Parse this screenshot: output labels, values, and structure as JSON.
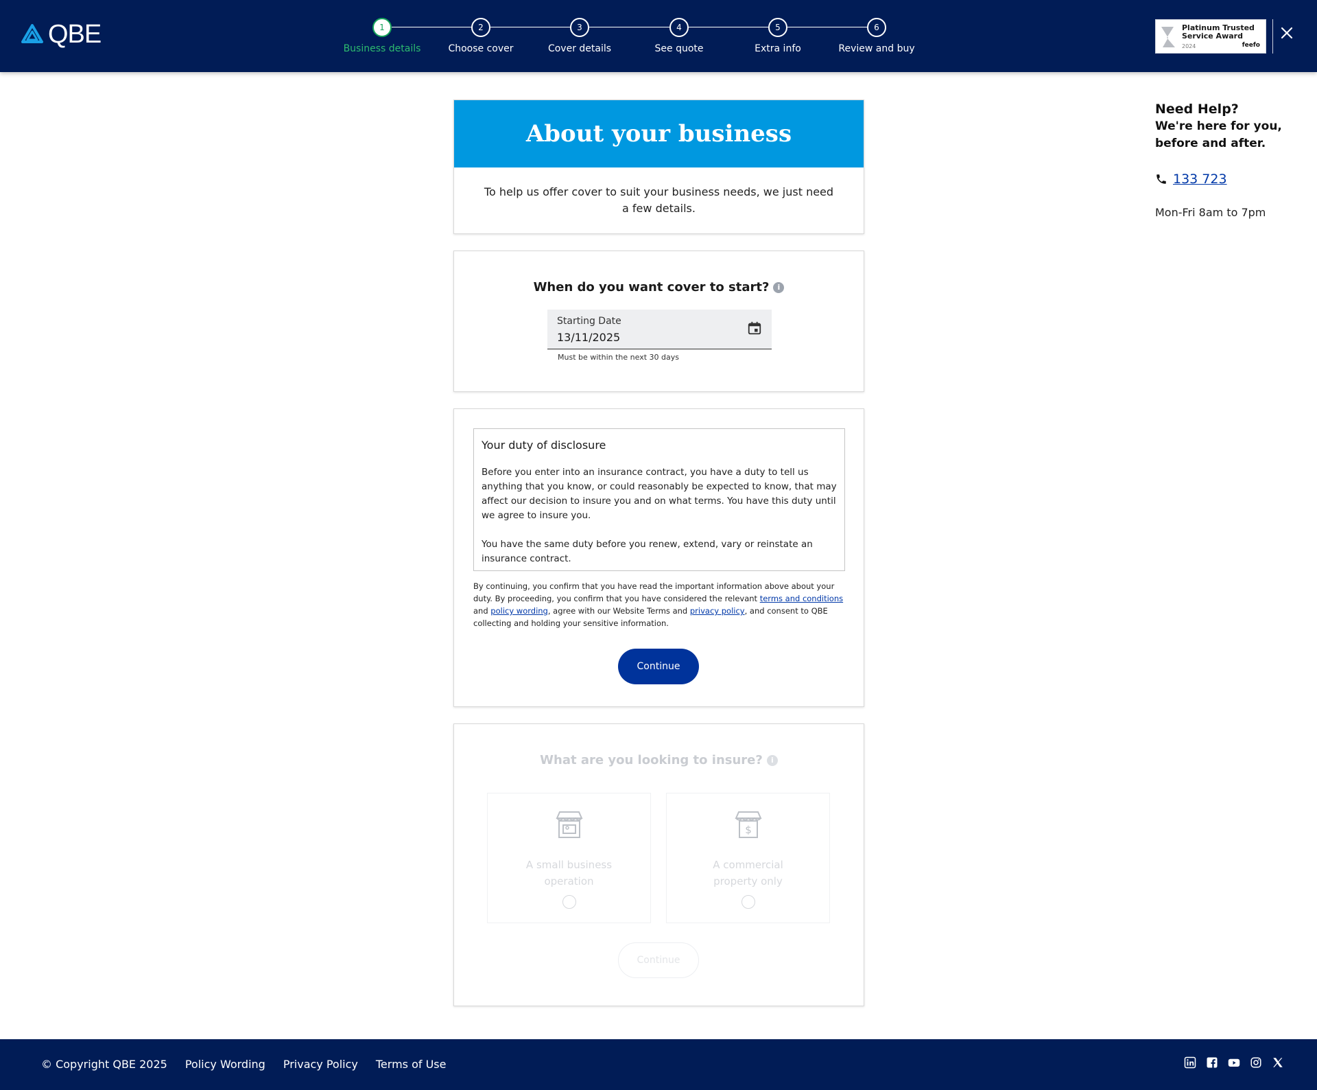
{
  "header": {
    "logo_text": "QBE",
    "steps": [
      {
        "num": "1",
        "label": "Business details",
        "active": true
      },
      {
        "num": "2",
        "label": "Choose cover"
      },
      {
        "num": "3",
        "label": "Cover details"
      },
      {
        "num": "4",
        "label": "See quote"
      },
      {
        "num": "5",
        "label": "Extra info"
      },
      {
        "num": "6",
        "label": "Review and buy"
      }
    ],
    "award": {
      "title": "Platinum Trusted Service Award",
      "year": "2024",
      "brand": "feefo"
    }
  },
  "hero": {
    "title": "About your business",
    "text": "To help us offer cover to suit your business needs, we just need a few details."
  },
  "start_date": {
    "question": "When do you want cover to start?",
    "info": "i",
    "field_label": "Starting Date",
    "field_value": "13/11/2025",
    "hint": "Must be within the next 30 days"
  },
  "disclosure": {
    "title": "Your duty of disclosure",
    "p1": "Before you enter into an insurance contract, you have a duty to tell us anything that you know, or could reasonably be expected to know, that may affect our decision to insure you and on what terms. You have this duty until we agree to insure you.",
    "p2": "You have the same duty before you renew, extend, vary or reinstate an insurance contract.",
    "consent_a": "By continuing, you confirm that you have read the important information above about your duty. By proceeding, you confirm that you have considered the relevant ",
    "link_terms": "terms and conditions",
    "consent_b": " and ",
    "link_policy": "policy wording",
    "consent_c": ", agree with our Website Terms and ",
    "link_privacy": "privacy policy",
    "consent_d": ", and consent to QBE collecting and holding your sensitive information.",
    "continue_label": "Continue"
  },
  "insure": {
    "question": "What are you looking to insure?",
    "info": "i",
    "options": [
      {
        "label": "A small business operation",
        "icon": "storefront-icon"
      },
      {
        "label": "A commercial property only",
        "icon": "storefront-dollar-icon"
      }
    ],
    "continue_label": "Continue"
  },
  "help": {
    "title": "Need Help?",
    "subtitle": "We're here for you, before and after.",
    "phone": "133 723",
    "hours": "Mon-Fri 8am to 7pm"
  },
  "footer": {
    "copyright": "© Copyright QBE 2025",
    "links": [
      "Policy Wording",
      "Privacy Policy",
      "Terms of Use"
    ],
    "socials": [
      "linkedin-icon",
      "facebook-icon",
      "youtube-icon",
      "instagram-icon",
      "x-icon"
    ]
  },
  "colors": {
    "navy": "#011c56",
    "hero_blue": "#0098e0",
    "button_blue": "#00339b",
    "active_green": "#16a45b",
    "link_blue": "#0038a8"
  }
}
